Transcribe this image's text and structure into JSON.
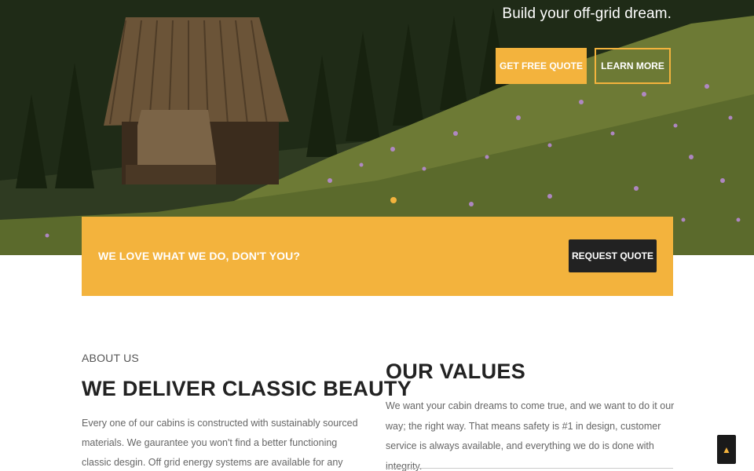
{
  "hero": {
    "tagline": "Build your off-grid dream.",
    "primary_button": "GET FREE QUOTE",
    "secondary_button": "LEARN MORE"
  },
  "cta": {
    "text": "WE LOVE WHAT WE DO, DON'T YOU?",
    "button": "REQUEST QUOTE"
  },
  "about": {
    "eyebrow": "ABOUT US",
    "title": "WE DELIVER CLASSIC BEAUTY",
    "body": "Every one of our cabins is constructed with sustainably sourced materials. We gaurantee you won't find a better functioning classic desgin. Off grid energy systems are available for any climate. We also have satellite"
  },
  "values": {
    "title": "OUR VALUES",
    "body": "We want your cabin dreams to come true, and we want to do it our way; the right way. That means safety is #1 in design, customer service is always available, and everything we do is done with integrity."
  },
  "scroll_top": {
    "icon": "double-chevron-up-icon"
  },
  "colors": {
    "accent": "#f3b33d",
    "dark": "#222222"
  }
}
